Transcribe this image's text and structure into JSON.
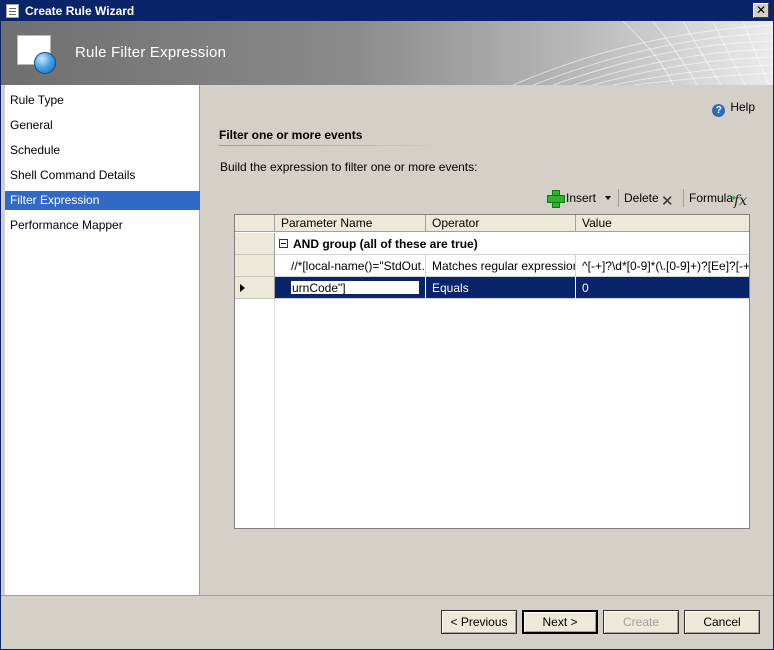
{
  "window": {
    "title": "Create Rule Wizard",
    "close_label": "✕"
  },
  "banner": {
    "heading": "Rule Filter Expression"
  },
  "nav": {
    "items": [
      {
        "label": "Rule Type",
        "selected": false
      },
      {
        "label": "General",
        "selected": false
      },
      {
        "label": "Schedule",
        "selected": false
      },
      {
        "label": "Shell Command Details",
        "selected": false
      },
      {
        "label": "Filter Expression",
        "selected": true
      },
      {
        "label": "Performance Mapper",
        "selected": false
      }
    ]
  },
  "content": {
    "help_label": "Help",
    "section_title": "Filter one or more events",
    "instructions": "Build the expression to filter one or more events:"
  },
  "toolbar": {
    "insert_label": "Insert",
    "delete_label": "Delete",
    "formula_label": "Formula"
  },
  "grid": {
    "columns": [
      "Parameter Name",
      "Operator",
      "Value"
    ],
    "group_label": "AND group (all of these are true)",
    "rows": [
      {
        "parameter": "//*[local-name()=\"StdOut…",
        "operator": "Matches regular expression",
        "value": "^[-+]?\\d*[0-9]*(\\.[0-9]+)?[Ee]?[-+]…"
      },
      {
        "parameter": "urnCode\"]",
        "operator": "Equals",
        "value": "0"
      }
    ]
  },
  "buttons": {
    "previous": "< Previous",
    "next": "Next >",
    "create": "Create",
    "cancel": "Cancel"
  },
  "colors": {
    "titlebar": "#0a246a",
    "selection": "#3169c6",
    "grid_selection": "#0a246a"
  }
}
